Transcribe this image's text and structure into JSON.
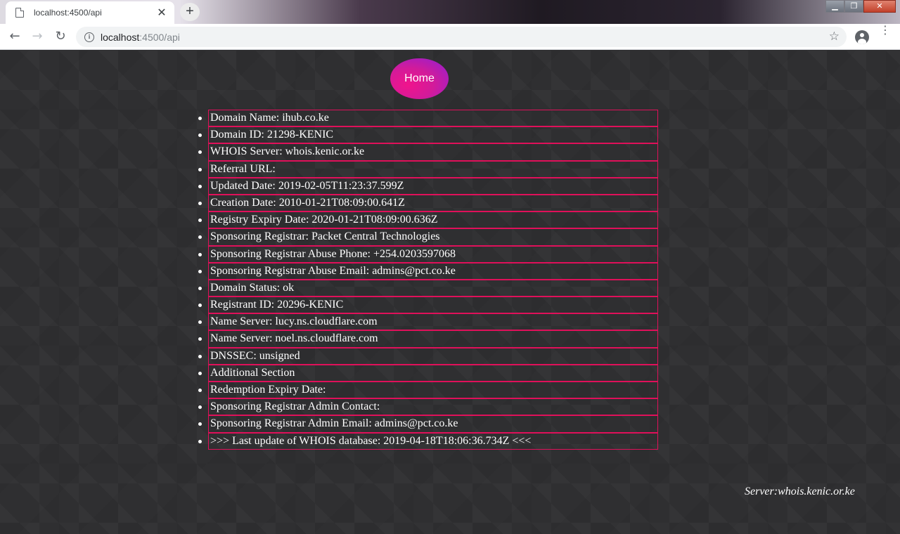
{
  "browser": {
    "tab_title": "localhost:4500/api",
    "tab_close": "✕",
    "new_tab": "+",
    "url_host": "localhost",
    "url_rest": ":4500/api",
    "window_controls": {
      "minimize": "▁",
      "restore": "❐",
      "close": "✕"
    }
  },
  "nav": {
    "back": "←",
    "forward": "→",
    "reload": "↻",
    "star": "☆",
    "menu": "⋮"
  },
  "page": {
    "home_label": "Home",
    "server_note": "Server:whois.kenic.or.ke",
    "items": [
      "Domain Name: ihub.co.ke",
      "Domain ID: 21298-KENIC",
      "WHOIS Server: whois.kenic.or.ke",
      "Referral URL:",
      "Updated Date: 2019-02-05T11:23:37.599Z",
      "Creation Date: 2010-01-21T08:09:00.641Z",
      "Registry Expiry Date: 2020-01-21T08:09:00.636Z",
      "Sponsoring Registrar: Packet Central Technologies",
      "Sponsoring Registrar Abuse Phone: +254.0203597068",
      "Sponsoring Registrar Abuse Email: admins@pct.co.ke",
      "Domain Status: ok",
      "Registrant ID: 20296-KENIC",
      "Name Server: lucy.ns.cloudflare.com",
      "Name Server: noel.ns.cloudflare.com",
      "DNSSEC: unsigned",
      "Additional Section",
      "Redemption Expiry Date:",
      "Sponsoring Registrar Admin Contact:",
      "Sponsoring Registrar Admin Email: admins@pct.co.ke",
      ">>> Last update of WHOIS database: 2019-04-18T18:06:36.734Z <<<"
    ]
  },
  "colors": {
    "item_border": "#e0105a",
    "page_background": "#2f2f31",
    "home_gradient_start": "#f0148c",
    "home_gradient_end": "#8f1fd6"
  }
}
